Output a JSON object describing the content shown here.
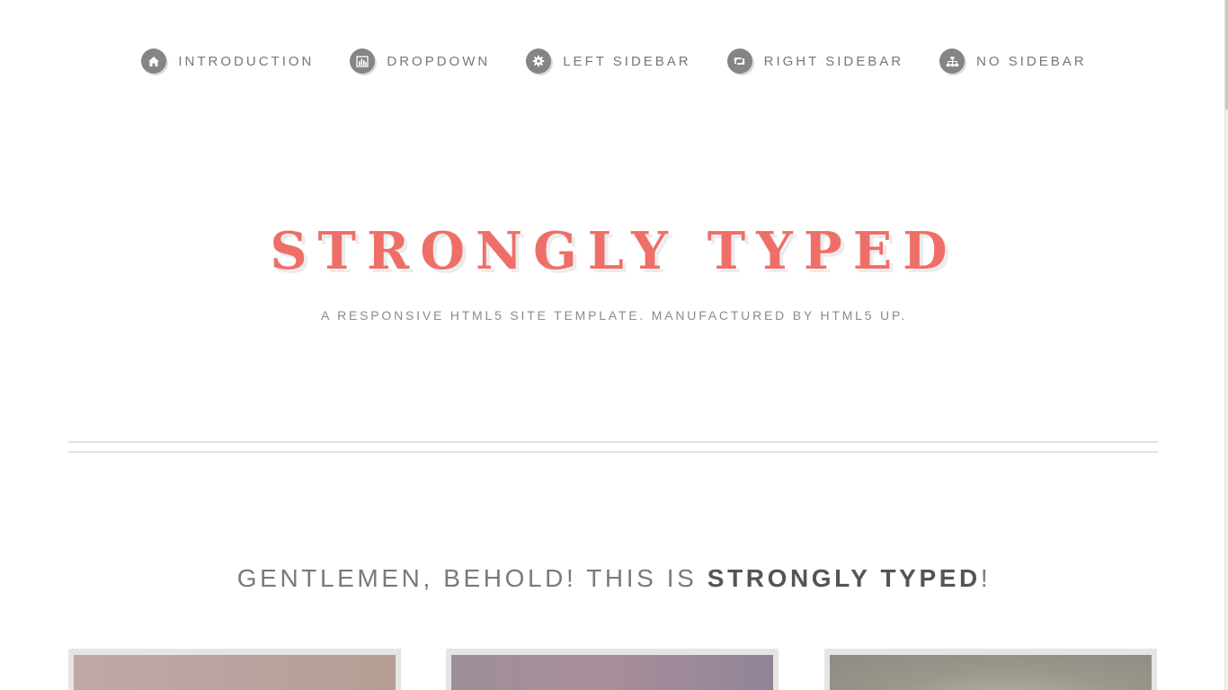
{
  "nav": {
    "items": [
      {
        "label": "Introduction",
        "icon": "home-icon"
      },
      {
        "label": "Dropdown",
        "icon": "bar-chart-icon"
      },
      {
        "label": "Left Sidebar",
        "icon": "gear-icon"
      },
      {
        "label": "Right Sidebar",
        "icon": "retweet-icon"
      },
      {
        "label": "No Sidebar",
        "icon": "sitemap-icon"
      }
    ]
  },
  "header": {
    "title": "STRONGLY TYPED",
    "tagline": "A RESPONSIVE HTML5 SITE TEMPLATE. MANUFACTURED BY HTML5 UP."
  },
  "intro": {
    "heading_prefix": "GENTLEMEN, BEHOLD! THIS IS ",
    "heading_strong": "STRONGLY TYPED",
    "heading_suffix": "!"
  },
  "colors": {
    "accent": "#ee6f68",
    "nav_icon_bg": "#858585",
    "text": "#777777"
  }
}
